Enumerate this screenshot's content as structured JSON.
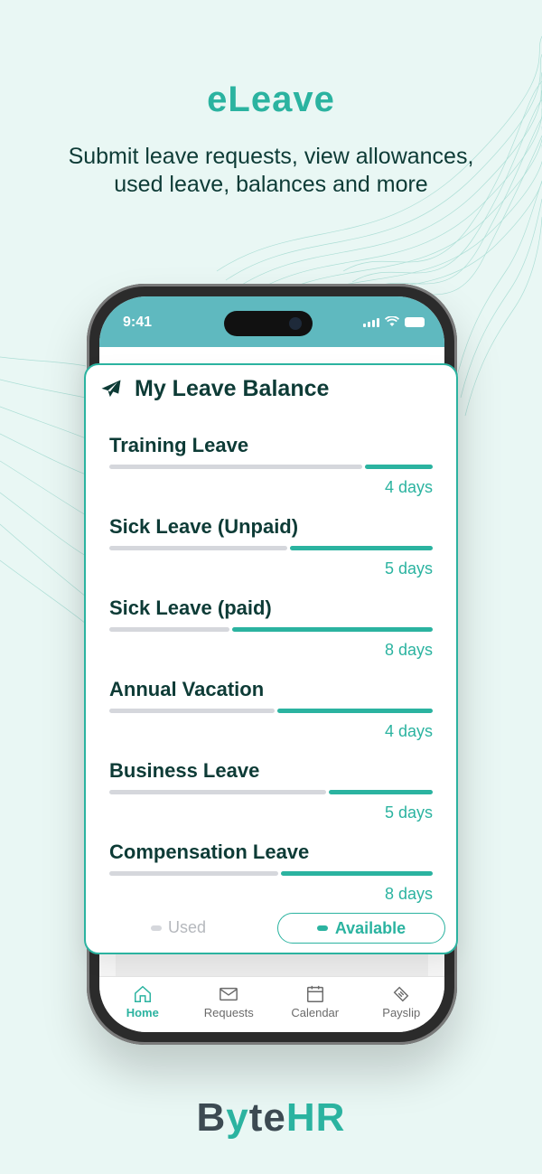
{
  "header": {
    "title": "eLeave",
    "subtitle": "Submit leave requests, view allowances, used leave, balances and more"
  },
  "status_bar": {
    "time": "9:41"
  },
  "card": {
    "title": "My Leave Balance",
    "icon": "airplane-icon",
    "items": [
      {
        "name": "Training Leave",
        "days": "4 days",
        "available_fraction": 0.21
      },
      {
        "name": "Sick Leave (Unpaid)",
        "days": "5 days",
        "available_fraction": 0.44
      },
      {
        "name": "Sick Leave (paid)",
        "days": "8 days",
        "available_fraction": 0.62
      },
      {
        "name": "Annual Vacation",
        "days": "4 days",
        "available_fraction": 0.48
      },
      {
        "name": "Business Leave",
        "days": "5 days",
        "available_fraction": 0.32
      },
      {
        "name": "Compensation Leave",
        "days": "8 days",
        "available_fraction": 0.47
      }
    ],
    "legend": {
      "used": "Used",
      "available": "Available"
    }
  },
  "tabbar": {
    "tabs": [
      {
        "label": "Home",
        "icon": "home-icon",
        "active": true
      },
      {
        "label": "Requests",
        "icon": "mail-icon",
        "active": false
      },
      {
        "label": "Calendar",
        "icon": "calendar-icon",
        "active": false
      },
      {
        "label": "Payslip",
        "icon": "ticket-icon",
        "active": false
      }
    ]
  },
  "logo": {
    "part1": "B",
    "part2": "y",
    "part3": "te",
    "part4": "HR"
  },
  "colors": {
    "accent": "#2bb3a0",
    "dark": "#0d3b36",
    "used": "#d5d7dc",
    "background": "#e9f7f4"
  }
}
